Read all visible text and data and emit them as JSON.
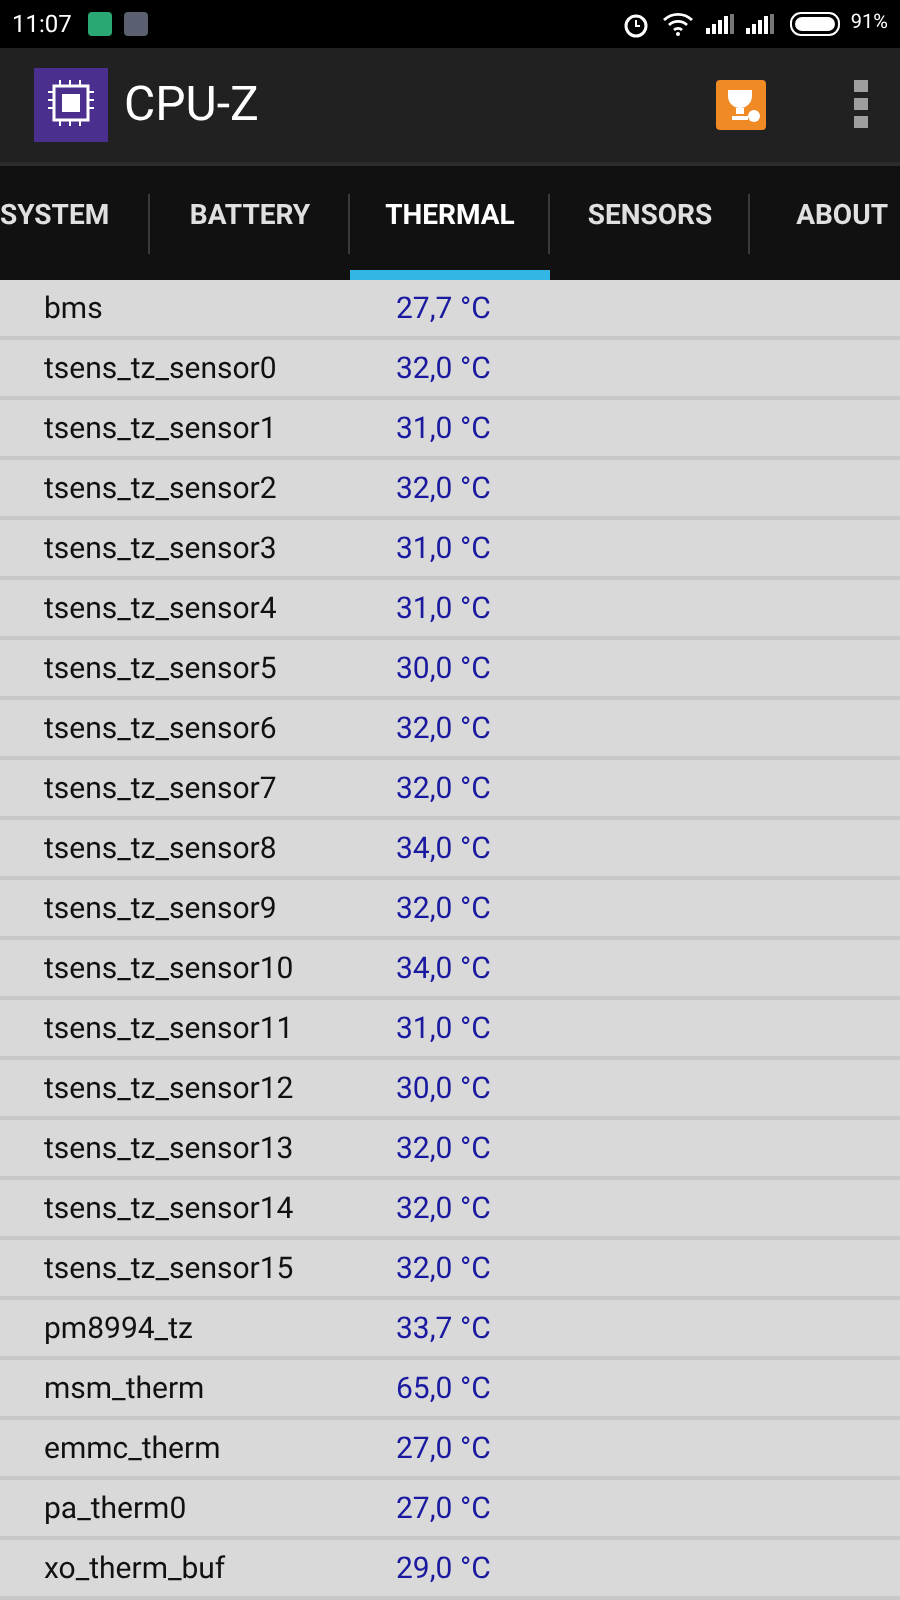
{
  "status_bar": {
    "time": "11:07",
    "battery": "91%"
  },
  "app_bar": {
    "title": "CPU-Z"
  },
  "tabs": [
    {
      "label": "SYSTEM",
      "selected": false
    },
    {
      "label": "BATTERY",
      "selected": false
    },
    {
      "label": "THERMAL",
      "selected": true
    },
    {
      "label": "SENSORS",
      "selected": false
    },
    {
      "label": "ABOUT",
      "selected": false
    }
  ],
  "rows": [
    {
      "name": "bms",
      "value": "27,7 °C"
    },
    {
      "name": "tsens_tz_sensor0",
      "value": "32,0 °C"
    },
    {
      "name": "tsens_tz_sensor1",
      "value": "31,0 °C"
    },
    {
      "name": "tsens_tz_sensor2",
      "value": "32,0 °C"
    },
    {
      "name": "tsens_tz_sensor3",
      "value": "31,0 °C"
    },
    {
      "name": "tsens_tz_sensor4",
      "value": "31,0 °C"
    },
    {
      "name": "tsens_tz_sensor5",
      "value": "30,0 °C"
    },
    {
      "name": "tsens_tz_sensor6",
      "value": "32,0 °C"
    },
    {
      "name": "tsens_tz_sensor7",
      "value": "32,0 °C"
    },
    {
      "name": "tsens_tz_sensor8",
      "value": "34,0 °C"
    },
    {
      "name": "tsens_tz_sensor9",
      "value": "32,0 °C"
    },
    {
      "name": "tsens_tz_sensor10",
      "value": "34,0 °C"
    },
    {
      "name": "tsens_tz_sensor11",
      "value": "31,0 °C"
    },
    {
      "name": "tsens_tz_sensor12",
      "value": "30,0 °C"
    },
    {
      "name": "tsens_tz_sensor13",
      "value": "32,0 °C"
    },
    {
      "name": "tsens_tz_sensor14",
      "value": "32,0 °C"
    },
    {
      "name": "tsens_tz_sensor15",
      "value": "32,0 °C"
    },
    {
      "name": "pm8994_tz",
      "value": "33,7 °C"
    },
    {
      "name": "msm_therm",
      "value": "65,0 °C"
    },
    {
      "name": "emmc_therm",
      "value": "27,0 °C"
    },
    {
      "name": "pa_therm0",
      "value": "27,0 °C"
    },
    {
      "name": "xo_therm_buf",
      "value": "29,0 °C"
    }
  ]
}
